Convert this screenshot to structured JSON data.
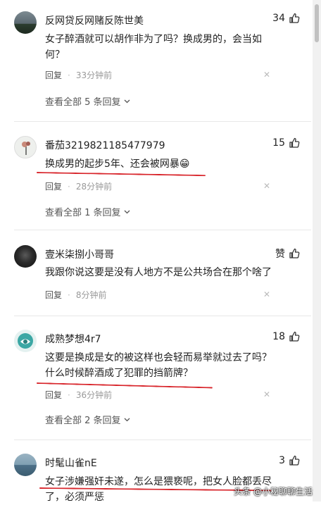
{
  "comments": [
    {
      "username": "反网贷反网赌反陈世美",
      "likes": "34",
      "lines": [
        "女子醉酒就可以胡作非为了吗？换成男的，会当如",
        "何？"
      ],
      "reply": "回复",
      "time": "33分钟前",
      "view_more": "查看全部 5 条回复"
    },
    {
      "username": "番茄3219821185477979",
      "likes": "15",
      "lines": [
        "换成男的起步5年、还会被网暴😁"
      ],
      "reply": "回复",
      "time": "28分钟前",
      "view_more": "查看全部 1 条回复"
    },
    {
      "username": "壹米柒捌小哥哥",
      "likes": "赞",
      "lines": [
        "我跟你说这要是没有人地方不是公共场合在那个啥了"
      ],
      "reply": "回复",
      "time": "8分钟前"
    },
    {
      "username": "成熟梦想4r7",
      "likes": "18",
      "lines": [
        "这要是换成是女的被这样也会轻而易举就过去了吗？",
        "什么时候醉酒成了犯罪的挡箭牌？"
      ],
      "reply": "回复",
      "time": "36分钟前",
      "view_more": "查看全部 2 条回复"
    },
    {
      "username": "时髦山雀nE",
      "likes": "3",
      "lines": [
        "女子涉嫌强奸未遂，怎么是猥亵呢，把女人脸都丢尽",
        "了，必须严惩"
      ]
    }
  ],
  "watermark": "头条 @小秘聊聊生活",
  "colors": {
    "underline": "#d8252b",
    "text": "#222222",
    "muted": "#999999"
  }
}
